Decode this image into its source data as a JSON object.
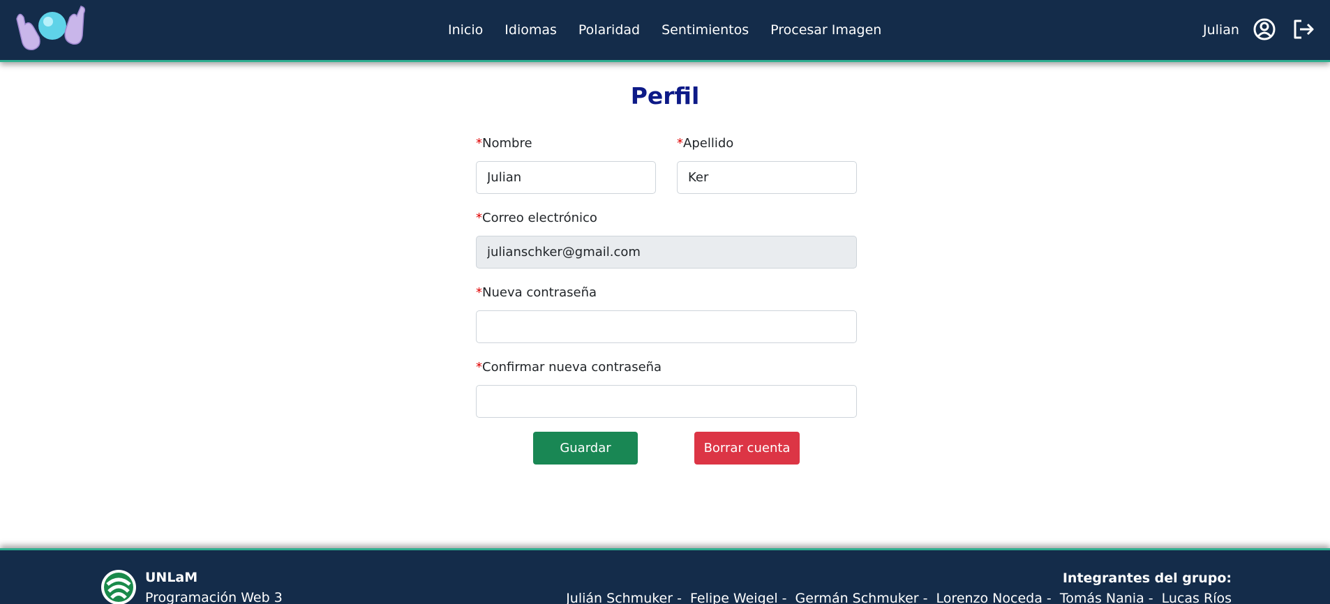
{
  "navbar": {
    "links": [
      "Inicio",
      "Idiomas",
      "Polaridad",
      "Sentimientos",
      "Procesar Imagen"
    ],
    "user_name": "Julian",
    "user_icon": "user-circle-icon",
    "logout_icon": "logout-icon",
    "logo_icon": "hands-crystal-ball-icon"
  },
  "form": {
    "title": "Perfil",
    "required_mark": "*",
    "fields": {
      "nombre": {
        "label": "Nombre",
        "value": "Julian",
        "placeholder": ""
      },
      "apellido": {
        "label": "Apellido",
        "value": "Ker",
        "placeholder": ""
      },
      "correo": {
        "label": "Correo electrónico",
        "value": "julianschker@gmail.com",
        "placeholder": ""
      },
      "nueva": {
        "label": "Nueva contraseña",
        "value": "",
        "placeholder": ""
      },
      "confirmar": {
        "label": "Confirmar nueva contraseña",
        "value": "",
        "placeholder": ""
      }
    },
    "buttons": {
      "save": "Guardar",
      "delete": "Borrar cuenta"
    }
  },
  "footer": {
    "org": "UNLaM",
    "course": "Programación Web 3",
    "team_title": "Integrantes del grupo:",
    "members": [
      "Julián Schmuker -",
      "Felipe Weigel -",
      "Germán Schmuker -",
      "Lorenzo Noceda -",
      "Tomás Nania -",
      "Lucas Ríos"
    ]
  },
  "colors": {
    "navbar": "#142c4a",
    "accent_line": "#2fae8f",
    "title": "#0d1a87",
    "save": "#198754",
    "delete": "#dc3545",
    "required": "#e00000"
  }
}
